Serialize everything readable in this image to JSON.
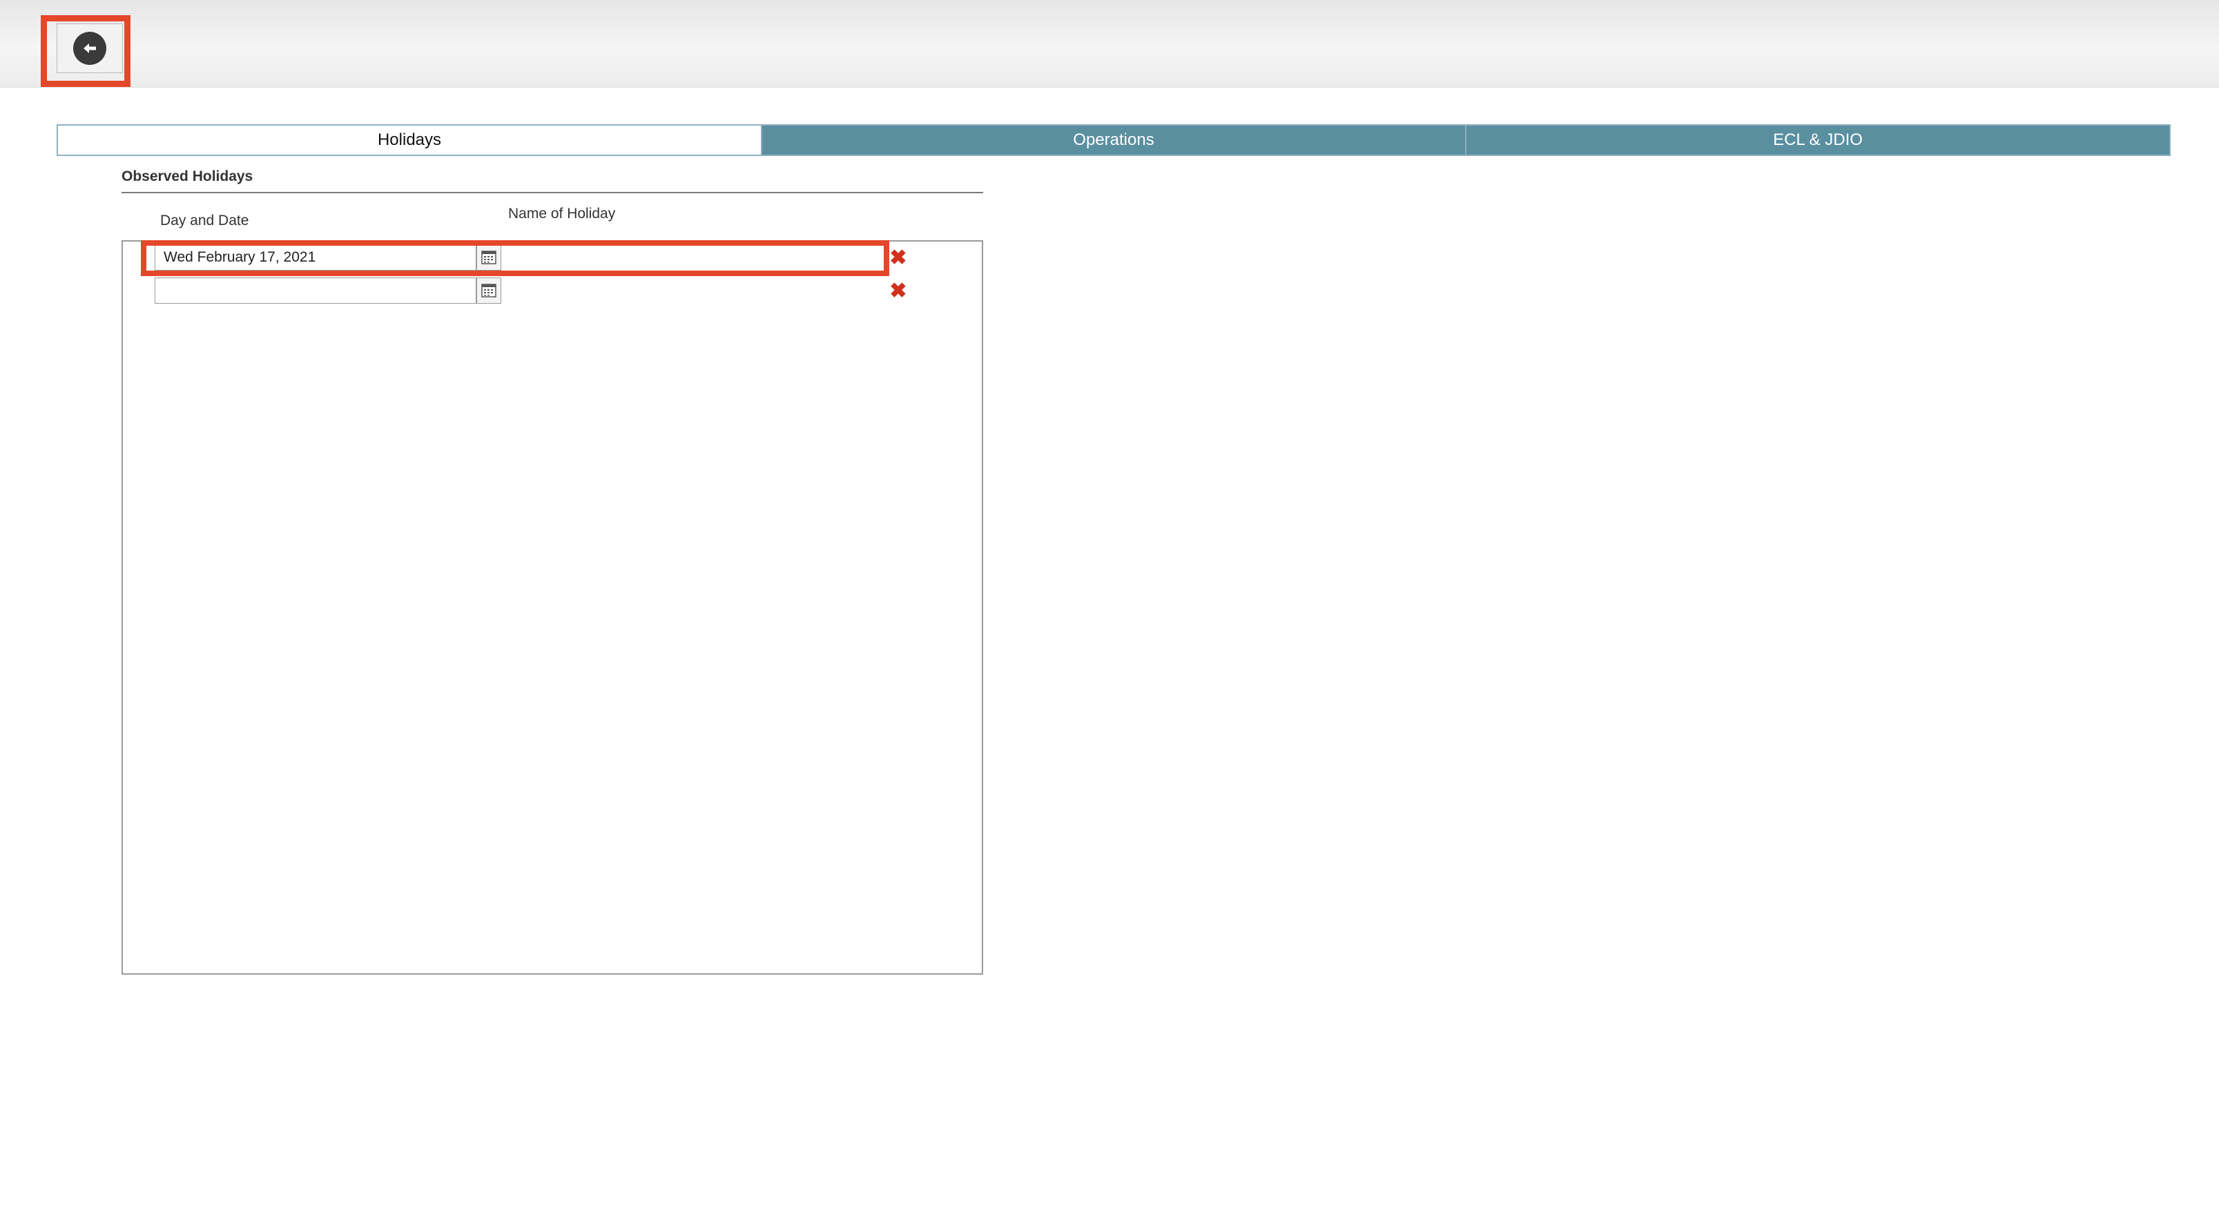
{
  "header": {
    "back_button_label": "Back",
    "icon": "arrow-left-circle-icon"
  },
  "tabs": [
    {
      "label": "Holidays",
      "active": true
    },
    {
      "label": "Operations",
      "active": false
    },
    {
      "label": "ECL & JDIO",
      "active": false
    }
  ],
  "section": {
    "title": "Observed Holidays",
    "col_date": "Day and Date",
    "col_name": "Name of Holiday"
  },
  "rows": [
    {
      "date": "Wed February 17, 2021",
      "name": ""
    },
    {
      "date": "",
      "name": ""
    }
  ],
  "colors": {
    "accent_tab": "#5a8fa0",
    "highlight": "#e5472a",
    "delete": "#d0301c"
  }
}
